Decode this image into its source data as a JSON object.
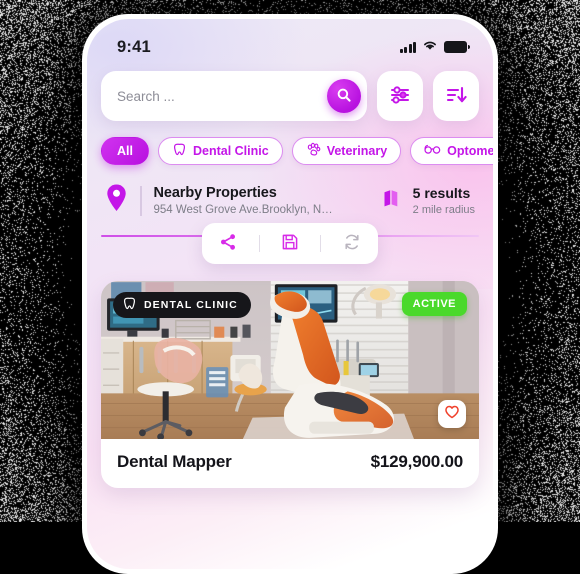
{
  "status_bar": {
    "time": "9:41",
    "signal_icon": "cellular-bars-icon",
    "wifi_icon": "wifi-icon",
    "battery_icon": "battery-full-icon"
  },
  "search": {
    "placeholder": "Search ...",
    "value": "",
    "submit_icon": "search-icon",
    "filter_icon": "filter-sliders-icon",
    "sort_icon": "sort-descending-icon"
  },
  "chips": [
    {
      "label": "All",
      "icon": null,
      "active": true
    },
    {
      "label": "Dental Clinic",
      "icon": "tooth-icon",
      "active": false
    },
    {
      "label": "Veterinary",
      "icon": "paw-icon",
      "active": false
    },
    {
      "label": "Optometry",
      "icon": "glasses-icon",
      "active": false
    }
  ],
  "nearby": {
    "pin_icon": "location-pin-icon",
    "title": "Nearby Properties",
    "address": "954 West Grove Ave.Brooklyn, N…",
    "map_icon": "folded-map-icon",
    "results_count": "5 results",
    "radius": "2 mile radius"
  },
  "action_bar": {
    "share_icon": "share-icon",
    "save_icon": "floppy-save-icon",
    "refresh_icon": "refresh-icon"
  },
  "card": {
    "type_badge": "DENTAL CLINIC",
    "type_badge_icon": "tooth-icon",
    "status_badge": "ACTIVE",
    "favorite_icon": "heart-icon",
    "title": "Dental Mapper",
    "price": "$129,900.00",
    "photo_alt": "dental-clinic-interior-photo"
  },
  "colors": {
    "accent": "#c416e8",
    "accent_deep": "#b810e0",
    "active_green": "#4ad92b",
    "badge_dark": "#16161a",
    "heart_red": "#f0412c",
    "text_primary": "#14141a",
    "text_muted": "#7d7d88"
  }
}
